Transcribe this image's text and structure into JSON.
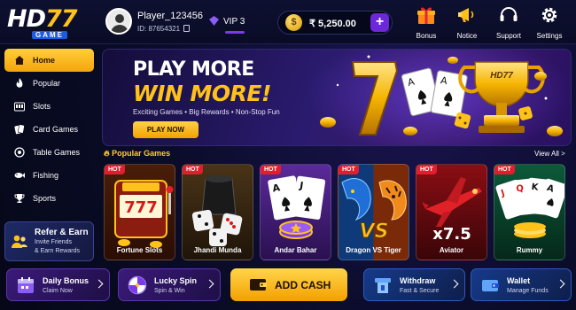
{
  "logo": {
    "hd": "HD",
    "num": "77",
    "game": "GAME"
  },
  "player": {
    "name": "Player_123456",
    "id": "ID: 87654321"
  },
  "vip": {
    "label": "VIP 3"
  },
  "wallet": {
    "coin": "$",
    "balance": "₹ 5,250.00",
    "add": "+"
  },
  "header_icons": [
    {
      "label": "Bonus",
      "icon": "gift-icon"
    },
    {
      "label": "Notice",
      "icon": "megaphone-icon"
    },
    {
      "label": "Support",
      "icon": "headset-icon"
    },
    {
      "label": "Settings",
      "icon": "gear-icon"
    }
  ],
  "sidebar": {
    "items": [
      {
        "label": "Home",
        "icon": "home-icon",
        "active": true
      },
      {
        "label": "Popular",
        "icon": "flame-icon"
      },
      {
        "label": "Slots",
        "icon": "slots-icon"
      },
      {
        "label": "Card Games",
        "icon": "cards-icon"
      },
      {
        "label": "Table Games",
        "icon": "table-icon"
      },
      {
        "label": "Fishing",
        "icon": "fish-icon"
      },
      {
        "label": "Sports",
        "icon": "trophy-icon"
      }
    ],
    "refer": {
      "title": "Refer & Earn",
      "line1": "Invite Friends",
      "line2": "& Earn Rewards"
    }
  },
  "banner": {
    "line1": "PLAY MORE",
    "line2": "WIN MORE!",
    "tagline": "Exciting Games • Big Rewards • Non-Stop Fun",
    "cta": "PLAY NOW",
    "trophy_text": "HD77"
  },
  "popular": {
    "title": "Popular Games",
    "view_all": "View All",
    "arrow": ">",
    "games": [
      {
        "name": "Fortune Slots",
        "badge": "HOT",
        "art": "777"
      },
      {
        "name": "Jhandi Munda",
        "badge": "HOT"
      },
      {
        "name": "Andar Bahar",
        "badge": "HOT"
      },
      {
        "name": "Dragon VS Tiger",
        "badge": "HOT",
        "art": "VS"
      },
      {
        "name": "Aviator",
        "badge": "HOT",
        "art": "x7.5"
      },
      {
        "name": "Rummy",
        "badge": "HOT"
      }
    ]
  },
  "bottom": {
    "daily_bonus": {
      "title": "Daily Bonus",
      "sub": "Claim Now"
    },
    "lucky_spin": {
      "title": "Lucky Spin",
      "sub": "Spin & Win"
    },
    "add_cash": {
      "label": "ADD CASH"
    },
    "withdraw": {
      "title": "Withdraw",
      "sub": "Fast & Secure"
    },
    "wallet": {
      "title": "Wallet",
      "sub": "Manage Funds"
    }
  },
  "colors": {
    "accent": "#ffc21a",
    "primary": "#6d28d9",
    "hot": "#e11d2e"
  }
}
